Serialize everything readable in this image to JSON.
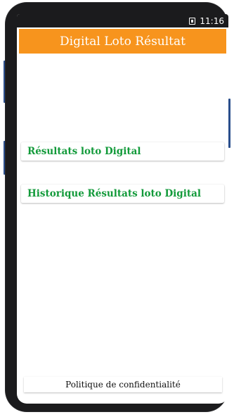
{
  "status_bar": {
    "time": "11:16",
    "icon": "notification-icon"
  },
  "app_bar": {
    "title": "Digital Loto Résultat",
    "color": "#f7941d"
  },
  "menu": {
    "items": [
      {
        "label": "Résultats loto Digital"
      },
      {
        "label": "Historique Résultats loto Digital"
      }
    ],
    "text_color": "#129a3a"
  },
  "footer": {
    "privacy_label": "Politique de confidentialité"
  }
}
